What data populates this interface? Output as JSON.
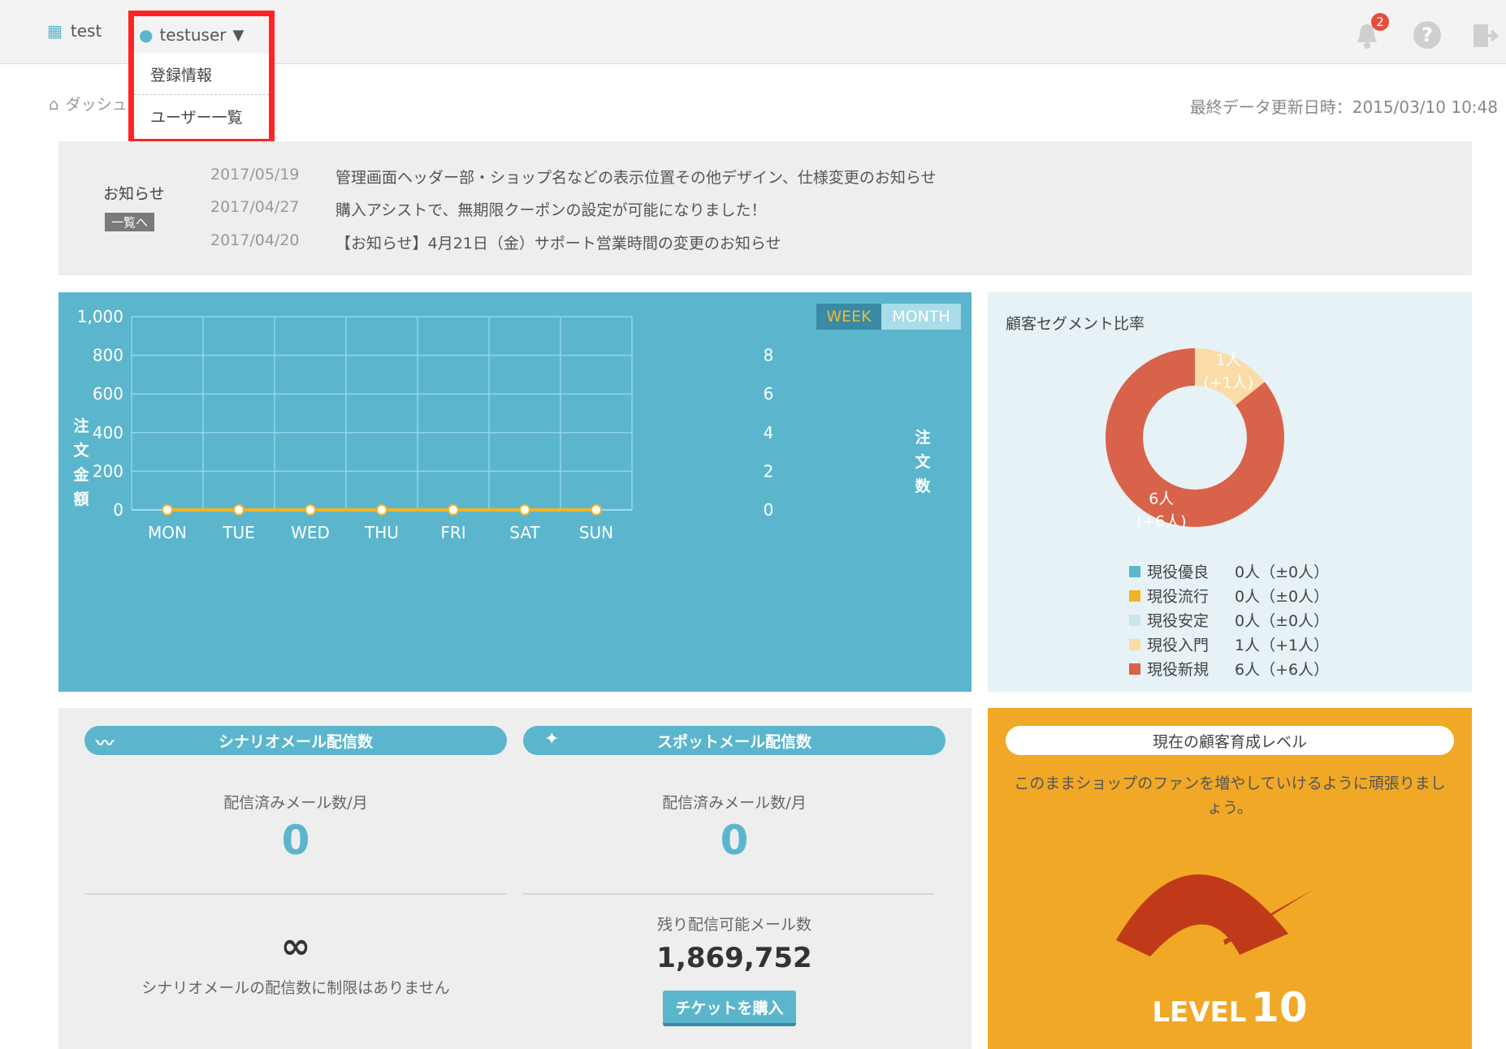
{
  "header": {
    "shop_name": "test",
    "user_name": "testuser",
    "notifications_count": "2"
  },
  "dropdown": {
    "items": [
      "登録情報",
      "ユーザー一覧"
    ]
  },
  "breadcrumb": {
    "label": "ダッシュ"
  },
  "last_update": "最終データ更新日時：2015/03/10 10:48",
  "news": {
    "title": "お知らせ",
    "all_link": "一覧へ",
    "items": [
      {
        "date": "2017/05/19",
        "text": "管理画面ヘッダー部・ショップ名などの表示位置その他デザイン、仕様変更のお知らせ"
      },
      {
        "date": "2017/04/27",
        "text": "購入アシストで、無期限クーポンの設定が可能になりました！"
      },
      {
        "date": "2017/04/20",
        "text": "【お知らせ】4月21日（金）サポート営業時間の変更のお知らせ"
      }
    ]
  },
  "chart_toggle": {
    "week": "WEEK",
    "month": "MONTH"
  },
  "chart_data": {
    "type": "line",
    "categories": [
      "MON",
      "TUE",
      "WED",
      "THU",
      "FRI",
      "SAT",
      "SUN"
    ],
    "series": [
      {
        "values": [
          0,
          0,
          0,
          0,
          0,
          0,
          0
        ]
      }
    ],
    "ylabel": "注文金額",
    "y2label": "注文数",
    "ylim": [
      0,
      1000
    ],
    "y2lim": [
      0,
      10
    ],
    "yticks": [
      "0",
      "200",
      "400",
      "600",
      "800",
      "1,000"
    ],
    "y2ticks": [
      "0",
      "2",
      "4",
      "6",
      "8"
    ],
    "grid": true,
    "colors": {
      "line": "#f0b429",
      "grid": "#8fd6e8"
    }
  },
  "segment": {
    "title": "顧客セグメント比率",
    "chart_data": {
      "type": "pie",
      "slices": [
        {
          "name": "現役入門",
          "value": 1,
          "label": "1人",
          "delta": "(+1人)",
          "color": "#fbdca6"
        },
        {
          "name": "現役新規",
          "value": 6,
          "label": "6人",
          "delta": "(+6人)",
          "color": "#d9624a"
        }
      ]
    },
    "legend": [
      {
        "name": "現役優良",
        "value": "0人（±0人）",
        "color": "#5bb6cd"
      },
      {
        "name": "現役流行",
        "value": "0人（±0人）",
        "color": "#f0b429"
      },
      {
        "name": "現役安定",
        "value": "0人（±0人）",
        "color": "#c9e6ee"
      },
      {
        "name": "現役入門",
        "value": "1人（+1人）",
        "color": "#fbdca6"
      },
      {
        "name": "現役新規",
        "value": "6人（+6人）",
        "color": "#d9624a"
      }
    ]
  },
  "scenario_mail": {
    "title": "シナリオメール配信数",
    "sent_label": "配信済みメール数/月",
    "sent_value": "0",
    "limit_symbol": "∞",
    "limit_text": "シナリオメールの配信数に制限はありません"
  },
  "spot_mail": {
    "title": "スポットメール配信数",
    "sent_label": "配信済みメール数/月",
    "sent_value": "0",
    "remaining_label": "残り配信可能メール数",
    "remaining_value": "1,869,752",
    "buy_button": "チケットを購入"
  },
  "level": {
    "title": "現在の顧客育成レベル",
    "message": "このままショップのファンを増やしていけるように頑張りましょう。",
    "level_word": "LEVEL",
    "level_number": "10"
  }
}
